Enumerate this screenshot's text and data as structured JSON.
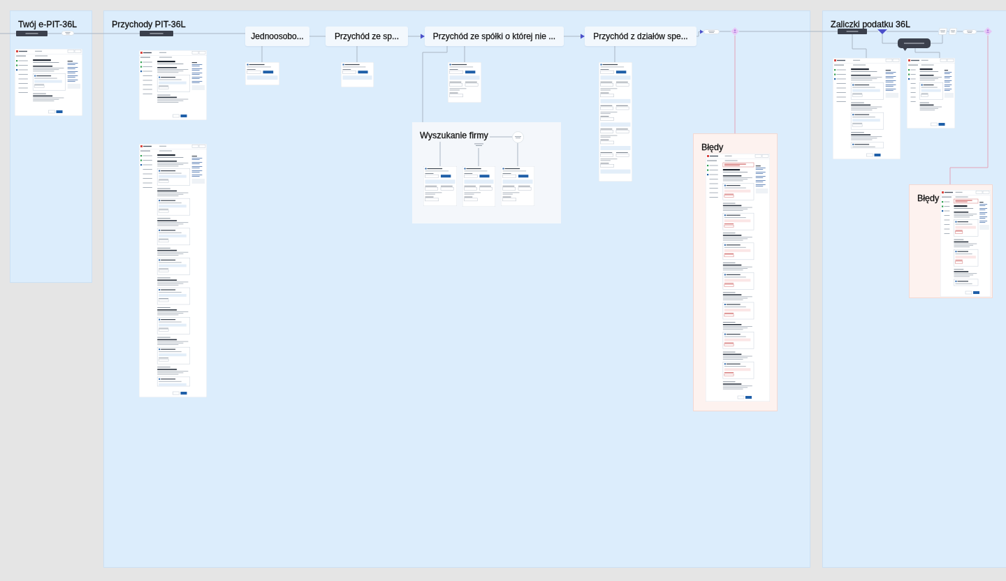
{
  "sections": [
    {
      "title": "Twój e-PIT-36L"
    },
    {
      "title": "Przychody PIT-36L",
      "steps": [
        {
          "title": "Jednoosobo..."
        },
        {
          "title": "Przychód ze sp..."
        },
        {
          "title": "Przychód ze spółki o której nie ..."
        },
        {
          "title": "Przychód z działów spe..."
        }
      ],
      "frames": [
        {
          "kind": "subflow",
          "title": "Wyszukanie firmy"
        },
        {
          "kind": "errors",
          "title": "Błędy"
        }
      ]
    },
    {
      "title": "Zaliczki podatku 36L",
      "frames": [
        {
          "kind": "errors",
          "title": "Błędy"
        }
      ]
    }
  ]
}
